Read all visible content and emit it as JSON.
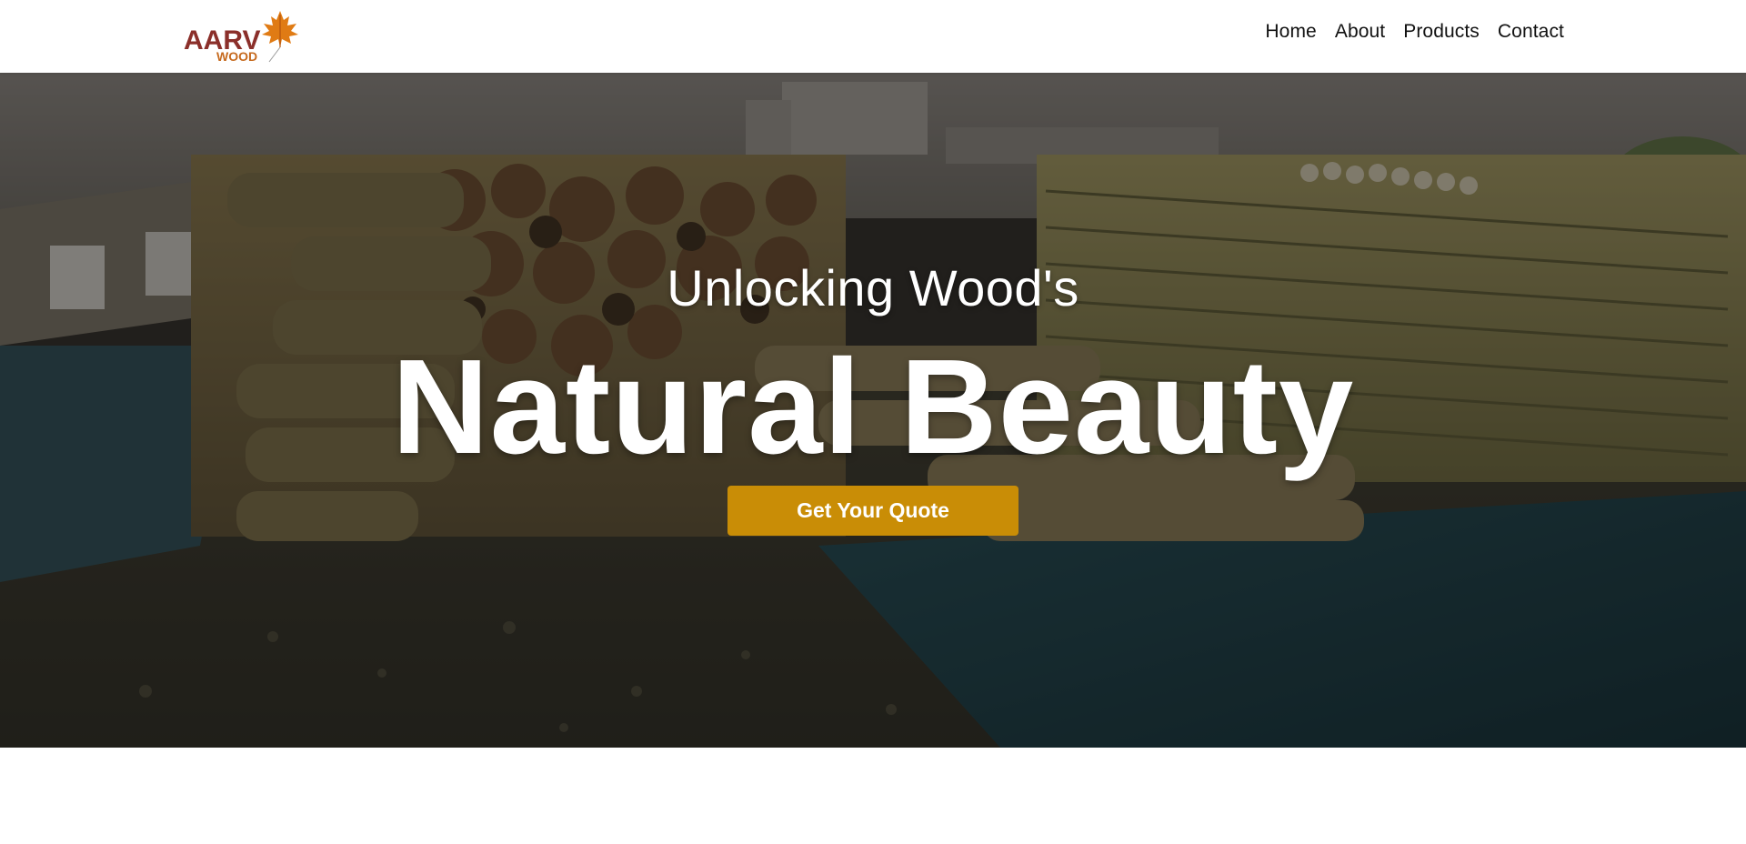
{
  "header": {
    "logo": {
      "text_main": "AARV",
      "text_sub": "WOOD",
      "icon": "maple-leaf-icon",
      "colors": {
        "main": "#8b2f2a",
        "sub": "#c66a1e",
        "leaf": "#e07b14"
      }
    },
    "nav": {
      "items": [
        {
          "label": "Home"
        },
        {
          "label": "About"
        },
        {
          "label": "Products"
        },
        {
          "label": "Contact"
        }
      ]
    }
  },
  "hero": {
    "subtitle": "Unlocking Wood's",
    "title": "Natural Beauty",
    "cta_label": "Get Your Quote",
    "colors": {
      "cta": "#c98d06",
      "text": "#ffffff"
    }
  }
}
